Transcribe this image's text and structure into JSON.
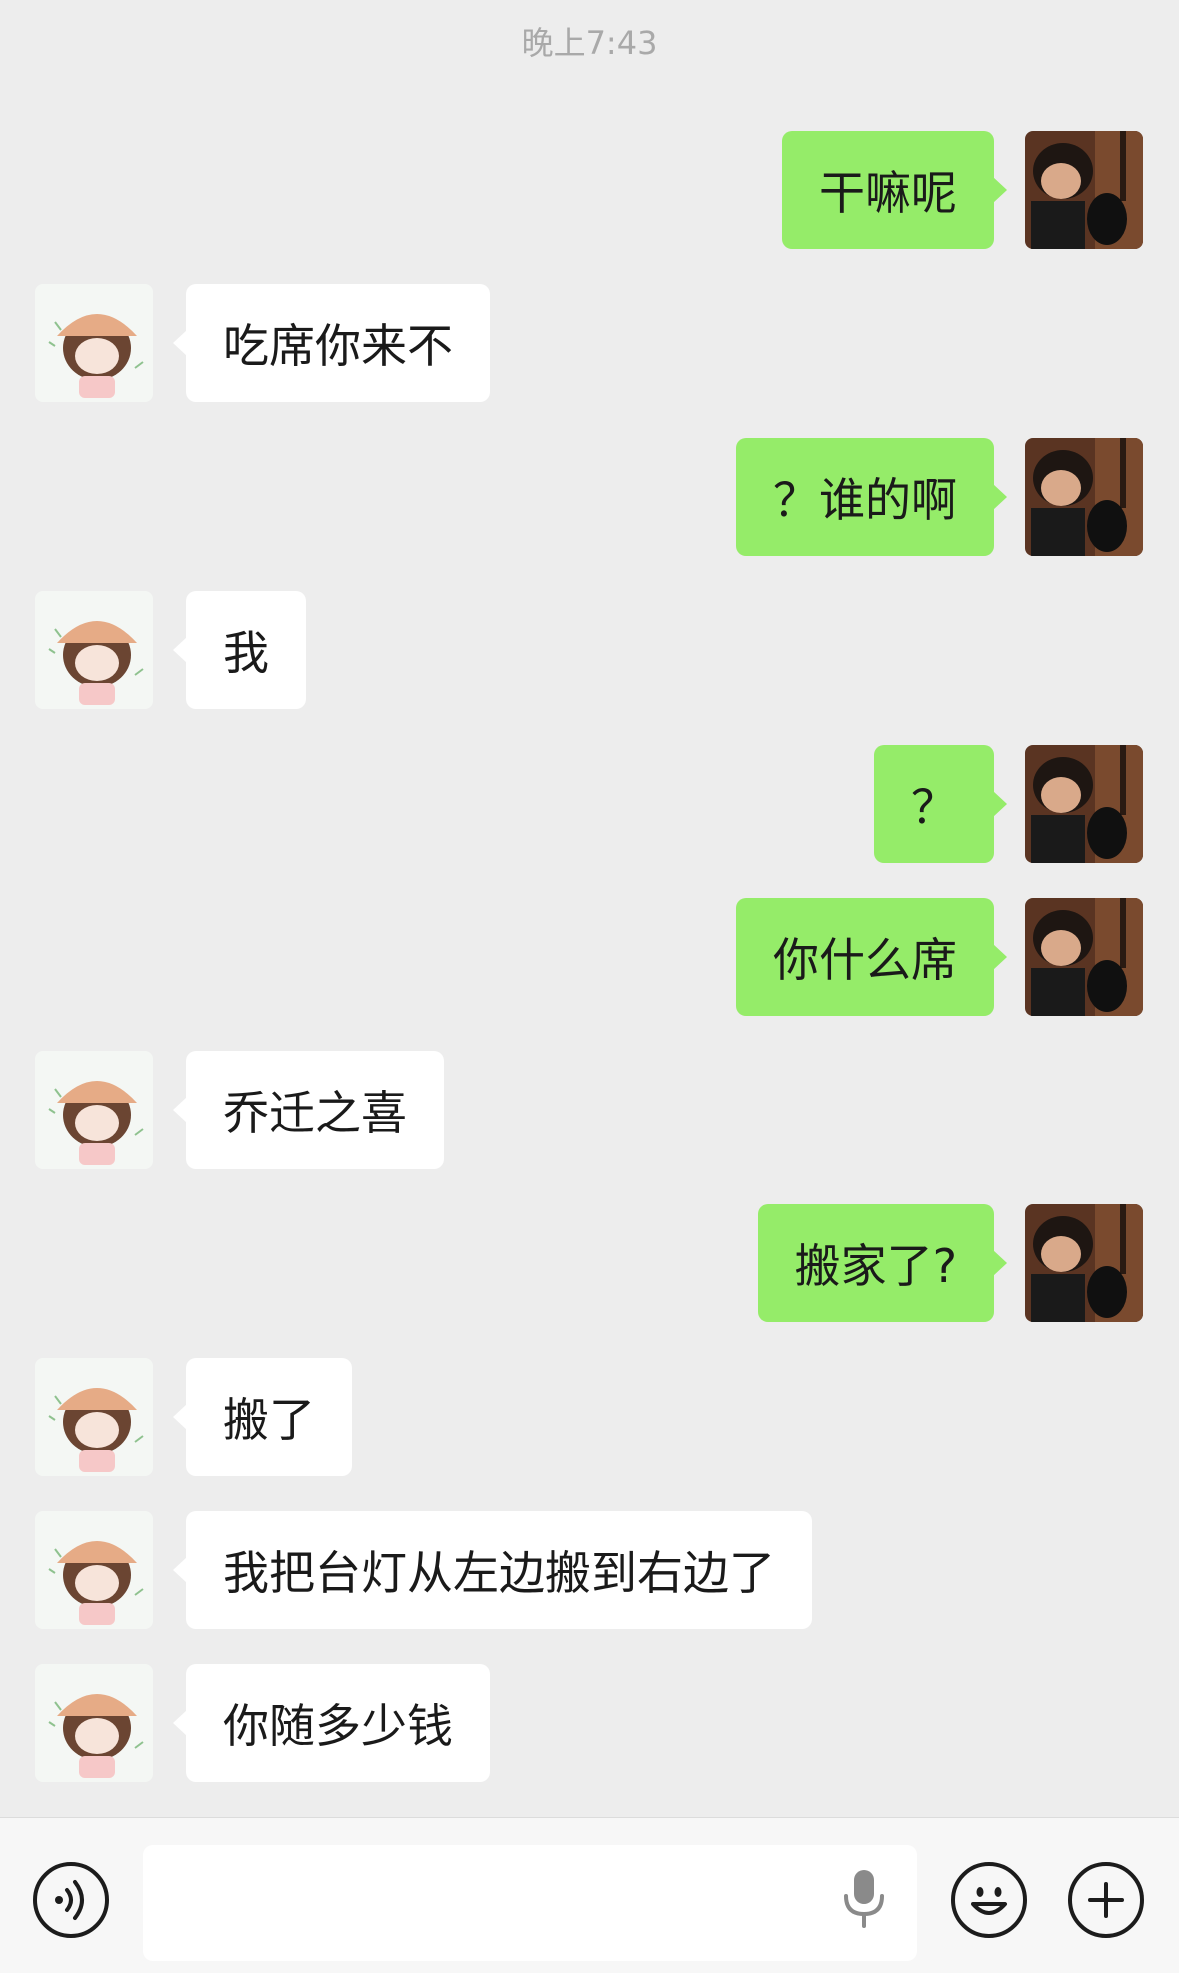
{
  "timestamp": "晚上7:43",
  "messages": [
    {
      "from": "me",
      "text": "干嘛呢"
    },
    {
      "from": "them",
      "text": "吃席你来不"
    },
    {
      "from": "me",
      "text": "？谁的啊"
    },
    {
      "from": "them",
      "text": "我"
    },
    {
      "from": "me",
      "text": "？"
    },
    {
      "from": "me",
      "text": "你什么席"
    },
    {
      "from": "them",
      "text": "乔迁之喜"
    },
    {
      "from": "me",
      "text": "搬家了?"
    },
    {
      "from": "them",
      "text": "搬了"
    },
    {
      "from": "them",
      "text": "我把台灯从左边搬到右边了"
    },
    {
      "from": "them",
      "text": "你随多少钱"
    }
  ],
  "input_bar": {
    "message_value": "",
    "voice_icon": "voice-toggle-icon",
    "mic_icon": "microphone-icon",
    "emoji_icon": "emoji-icon",
    "add_icon": "plus-icon"
  },
  "colors": {
    "background": "#ededed",
    "my_bubble": "#95ec69",
    "their_bubble": "#ffffff",
    "timestamp": "#a9a9a9"
  }
}
